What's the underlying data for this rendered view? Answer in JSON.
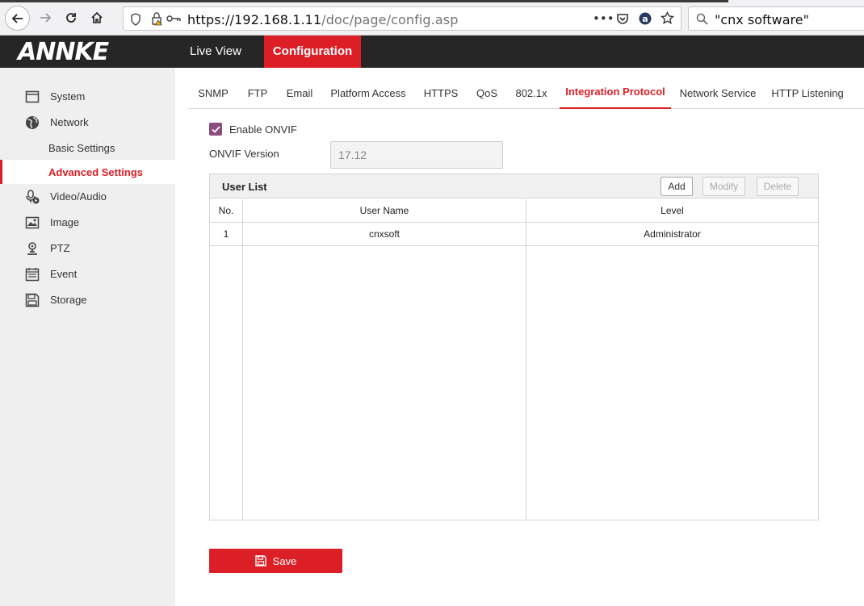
{
  "browser": {
    "url_host": "https://192.168.1.11",
    "url_path": "/doc/page/config.asp",
    "search_value": "\"cnx software\"",
    "more_label": "•••"
  },
  "app": {
    "logo": "ANNKE",
    "nav": {
      "live_view": "Live View",
      "configuration": "Configuration"
    }
  },
  "sidebar": {
    "items": [
      {
        "label": "System",
        "icon": "system-icon"
      },
      {
        "label": "Network",
        "icon": "globe-icon"
      },
      {
        "label": "Basic Settings"
      },
      {
        "label": "Advanced Settings"
      },
      {
        "label": "Video/Audio",
        "icon": "microphone-icon"
      },
      {
        "label": "Image",
        "icon": "image-icon"
      },
      {
        "label": "PTZ",
        "icon": "ptz-icon"
      },
      {
        "label": "Event",
        "icon": "calendar-icon"
      },
      {
        "label": "Storage",
        "icon": "storage-icon"
      }
    ]
  },
  "tabs": [
    "SNMP",
    "FTP",
    "Email",
    "Platform Access",
    "HTTPS",
    "QoS",
    "802.1x",
    "Integration Protocol",
    "Network Service",
    "HTTP Listening"
  ],
  "form": {
    "enable_onvif_label": "Enable ONVIF",
    "enable_onvif_checked": true,
    "onvif_version_label": "ONVIF Version",
    "onvif_version_value": "17.12"
  },
  "user_list": {
    "title": "User List",
    "buttons": {
      "add": "Add",
      "modify": "Modify",
      "delete": "Delete"
    },
    "columns": [
      "No.",
      "User Name",
      "Level"
    ],
    "rows": [
      {
        "no": "1",
        "user_name": "cnxsoft",
        "level": "Administrator"
      }
    ]
  },
  "save_label": "Save",
  "colors": {
    "accent": "#dc1f26",
    "header": "#262626",
    "sidebar": "#efefef",
    "checkbox": "#8a4d7f"
  }
}
